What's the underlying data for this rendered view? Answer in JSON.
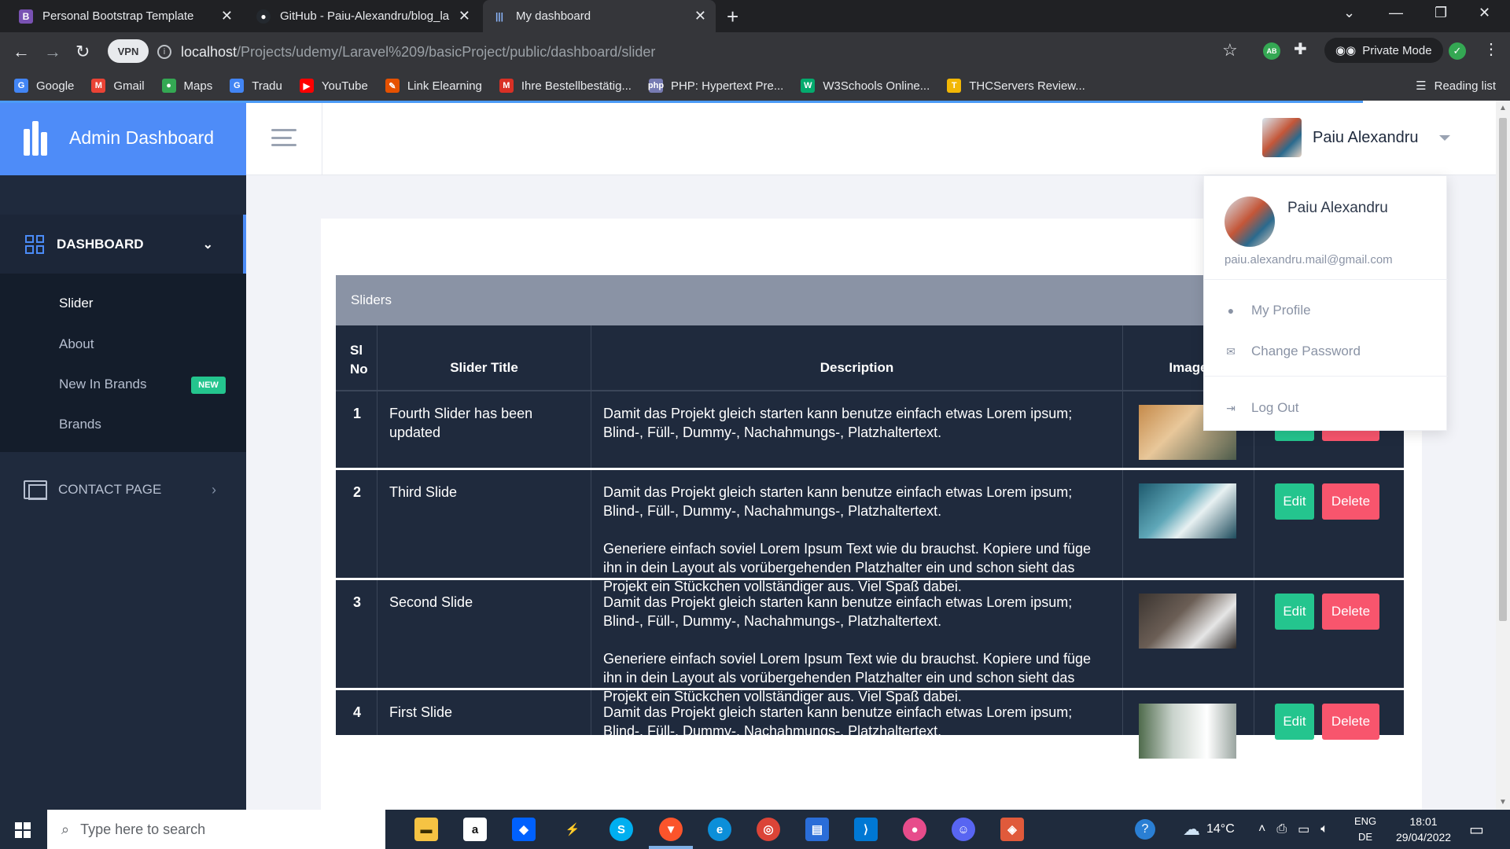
{
  "browser": {
    "tabs": [
      {
        "title": "Personal Bootstrap Template",
        "icon": "bootstrap-icon",
        "color": "#7952b3"
      },
      {
        "title": "GitHub - Paiu-Alexandru/blog_la",
        "icon": "github-icon",
        "color": "#24292f"
      },
      {
        "title": "My dashboard",
        "icon": "dashboard-icon",
        "color": "#4e8cf8"
      }
    ],
    "url_host": "localhost",
    "url_path": "/Projects/udemy/Laravel%209/basicProject/public/dashboard/slider",
    "vpn_label": "VPN",
    "private_label": "Private Mode",
    "ext_ab": "AB",
    "bookmarks": [
      {
        "label": "Google",
        "icon": "google-icon",
        "color": "#4285f4",
        "glyph": "G"
      },
      {
        "label": "Gmail",
        "icon": "gmail-icon",
        "color": "#ea4335",
        "glyph": "M"
      },
      {
        "label": "Maps",
        "icon": "maps-icon",
        "color": "#34a853",
        "glyph": "●"
      },
      {
        "label": "Tradu",
        "icon": "translate-icon",
        "color": "#4285f4",
        "glyph": "G"
      },
      {
        "label": "YouTube",
        "icon": "youtube-icon",
        "color": "#ff0000",
        "glyph": "▶"
      },
      {
        "label": "Link Elearning",
        "icon": "elearning-icon",
        "color": "#e65100",
        "glyph": "✎"
      },
      {
        "label": "Ihre Bestellbestätig...",
        "icon": "mail-icon",
        "color": "#d93025",
        "glyph": "M"
      },
      {
        "label": "PHP: Hypertext Pre...",
        "icon": "php-icon",
        "color": "#777bb3",
        "glyph": "php"
      },
      {
        "label": "W3Schools Online...",
        "icon": "w3schools-icon",
        "color": "#04aa6d",
        "glyph": "W"
      },
      {
        "label": "THCServers Review...",
        "icon": "thc-icon",
        "color": "#f2b705",
        "glyph": "T"
      }
    ],
    "reading_list": "Reading list"
  },
  "app": {
    "brand": "Admin Dashboard",
    "user_name": "Paiu Alexandru",
    "sidebar": {
      "dashboard": "DASHBOARD",
      "items": [
        "Slider",
        "About",
        "New In Brands",
        "Brands"
      ],
      "new_badge": "NEW",
      "contact": "CONTACT PAGE"
    },
    "panel_title": "Sliders",
    "table": {
      "headers": [
        "Sl No",
        "Slider Title",
        "Description",
        "Image"
      ],
      "rows": [
        {
          "no": "1",
          "title": "Fourth Slider has been updated",
          "desc": [
            "Damit das Projekt gleich starten kann benutze einfach etwas Lorem ipsum; Blind-, Füll-, Dummy-, Nachahmungs-, Platzhaltertext."
          ],
          "img": "linear-gradient(135deg,#c58a4a 0%,#e8c79a 40%,#4b5a4a 100%)"
        },
        {
          "no": "2",
          "title": "Third Slide",
          "desc": [
            "Damit das Projekt gleich starten kann benutze einfach etwas Lorem ipsum; Blind-, Füll-, Dummy-, Nachahmungs-, Platzhaltertext.",
            "Generiere einfach soviel Lorem Ipsum Text wie du brauchst. Kopiere und füge ihn in dein Layout als vorübergehenden Platzhalter ein und schon sieht das Projekt ein Stückchen vollständiger aus. Viel Spaß dabei."
          ],
          "img": "linear-gradient(135deg,#1e5a6e 0%,#5fa7b8 40%,#e8f1f2 60%,#1d4b5c 100%)"
        },
        {
          "no": "3",
          "title": "Second Slide",
          "desc": [
            "Damit das Projekt gleich starten kann benutze einfach etwas Lorem ipsum; Blind-, Füll-, Dummy-, Nachahmungs-, Platzhaltertext.",
            "Generiere einfach soviel Lorem Ipsum Text wie du brauchst. Kopiere und füge ihn in dein Layout als vorübergehenden Platzhalter ein und schon sieht das Projekt ein Stückchen vollständiger aus. Viel Spaß dabei."
          ],
          "img": "linear-gradient(135deg,#3b3531 0%,#6b5e55 40%,#e6e6e6 70%,#2f2a27 100%)"
        },
        {
          "no": "4",
          "title": "First Slide",
          "desc": [
            "Damit das Projekt gleich starten kann benutze einfach etwas Lorem ipsum; Blind-, Füll-, Dummy-, Nachahmungs-, Platzhaltertext."
          ],
          "img": "linear-gradient(90deg,#4f6b4c 0%,#c9d3cc 35%,#ffffff 70%,#9aa5a0 100%)"
        }
      ],
      "edit_label": "Edit",
      "delete_label": "Delete"
    },
    "dropdown": {
      "name": "Paiu Alexandru",
      "email": "paiu.alexandru.mail@gmail.com",
      "items": [
        "My Profile",
        "Change Password",
        "Log Out"
      ]
    }
  },
  "taskbar": {
    "search_placeholder": "Type here to search",
    "temperature": "14°C",
    "lang_top": "ENG",
    "lang_bottom": "DE",
    "time": "18:01",
    "date": "29/04/2022"
  }
}
